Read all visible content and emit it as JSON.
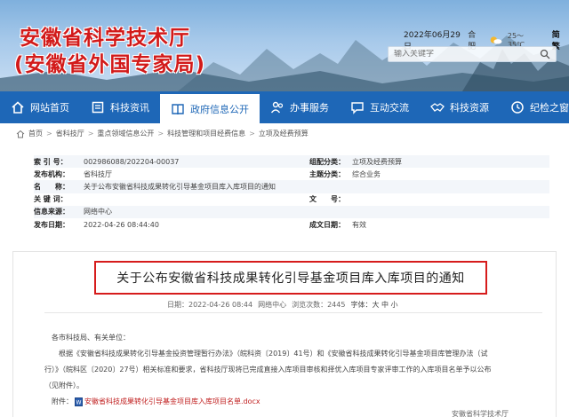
{
  "header": {
    "title_line1": "安徽省科学技术厅",
    "title_line2": "(安徽省外国专家局)",
    "date": "2022年06月29日",
    "city": "合肥",
    "temp": "25～35℃",
    "lang": "简 繁",
    "search_placeholder": "输入关键字"
  },
  "nav": {
    "items": [
      {
        "label": "网站首页",
        "icon": "home-icon"
      },
      {
        "label": "科技资讯",
        "icon": "news-icon"
      },
      {
        "label": "政府信息公开",
        "icon": "book-icon"
      },
      {
        "label": "办事服务",
        "icon": "people-icon"
      },
      {
        "label": "互动交流",
        "icon": "chat-icon"
      },
      {
        "label": "科技资源",
        "icon": "handshake-icon"
      },
      {
        "label": "纪检之窗",
        "icon": "clock-icon"
      }
    ]
  },
  "breadcrumb": [
    "首页",
    "省科技厅",
    "重点领域信息公开",
    "科技管理和项目经费信息",
    "立项及经费预算"
  ],
  "meta": {
    "index_label": "索 引 号：",
    "index_value": "002986088/202204-00037",
    "category_label": "组配分类：",
    "category_value": "立项及经费预算",
    "org_label": "发布机构：",
    "org_value": "省科技厅",
    "topic_label": "主题分类：",
    "topic_value": "综合业务",
    "name_label": "名　　称：",
    "name_value": "关于公布安徽省科技成果转化引导基金项目库入库项目的通知",
    "keywords_label": "关 键 词：",
    "keywords_value": "",
    "docno_label": "文　　号：",
    "docno_value": "",
    "source_label": "信息来源：",
    "source_value": "网络中心",
    "date_label": "发布日期：",
    "date_value": "2022-04-26 08:44:40",
    "status_label": "成文日期：",
    "status_value": "有效"
  },
  "article": {
    "title": "关于公布安徽省科技成果转化引导基金项目库入库项目的通知",
    "date_info": "日期：2022-04-26 08:44",
    "source_info": "网络中心",
    "views_info": "浏览次数：2445",
    "font_size_info": "字体：大 中 小",
    "salutation": "各市科技局、有关单位：",
    "body_line1": "根据《安徽省科技成果转化引导基金投资管理暂行办法》（皖科资〔2019〕41号）和《安徽省科技成果转化引导基金项目库管理办法（试",
    "body_line2": "行）》（皖科区〔2020〕27号）相关标准和要求，省科技厅现将已完成直接入库项目审核和择优入库项目专家评审工作的入库项目名单予以公布",
    "body_line3": "（见附件）。",
    "attachment_label": "附件：",
    "attachment_name": "安徽省科技成果转化引导基金项目库入库项目名单.docx",
    "signature": "安徽省科学技术厅"
  }
}
